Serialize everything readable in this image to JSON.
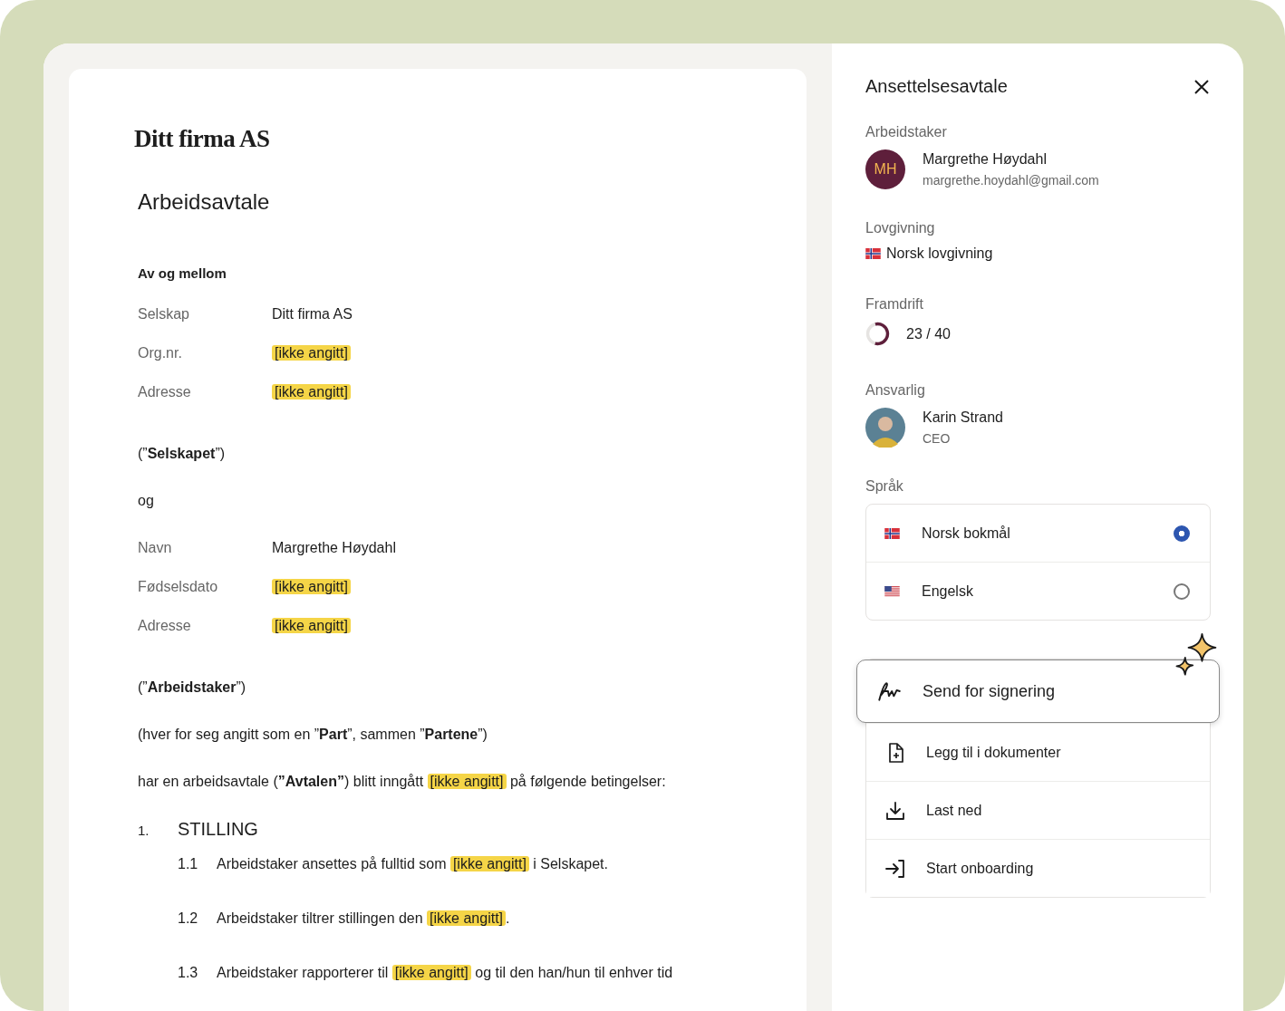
{
  "document": {
    "company": "Ditt firma AS",
    "title": "Arbeidsavtale",
    "parties_heading": "Av og mellom",
    "company_fields": [
      {
        "label": "Selskap",
        "value": "Ditt firma AS",
        "kind": "text"
      },
      {
        "label": "Org.nr.",
        "value": "[ikke angitt]",
        "kind": "placeholder"
      },
      {
        "label": "Adresse",
        "value": "[ikke angitt]",
        "kind": "placeholder"
      }
    ],
    "company_alias": [
      {
        "text": "(”",
        "kind": "plain"
      },
      {
        "text": "Selskapet",
        "kind": "bold"
      },
      {
        "text": "”)",
        "kind": "plain"
      }
    ],
    "conjunction": "og",
    "employee_fields": [
      {
        "label": "Navn",
        "value": "Margrethe Høydahl",
        "kind": "text"
      },
      {
        "label": "Fødselsdato",
        "value": "[ikke angitt]",
        "kind": "placeholder"
      },
      {
        "label": "Adresse",
        "value": "[ikke angitt]",
        "kind": "placeholder"
      }
    ],
    "paragraphs": [
      [
        {
          "text": "(”",
          "kind": "plain"
        },
        {
          "text": "Arbeidstaker",
          "kind": "bold"
        },
        {
          "text": "”)",
          "kind": "plain"
        }
      ],
      [
        {
          "text": "(hver for seg angitt som en ”",
          "kind": "plain"
        },
        {
          "text": "Part",
          "kind": "bold"
        },
        {
          "text": "”, sammen ”",
          "kind": "plain"
        },
        {
          "text": "Partene",
          "kind": "bold"
        },
        {
          "text": "”)",
          "kind": "plain"
        }
      ],
      [
        {
          "text": "har en arbeidsavtale (",
          "kind": "plain"
        },
        {
          "text": "”Avtalen”",
          "kind": "bold"
        },
        {
          "text": ") blitt inngått ",
          "kind": "plain"
        },
        {
          "text": "[ikke angitt]",
          "kind": "placeholder"
        },
        {
          "text": " på følgende betingelser:",
          "kind": "plain"
        }
      ]
    ],
    "sections": [
      {
        "number": "1.",
        "title": "STILLING",
        "clauses": [
          {
            "number": "1.1",
            "segments": [
              {
                "text": "Arbeidstaker ansettes på fulltid som ",
                "kind": "plain"
              },
              {
                "text": "[ikke angitt]",
                "kind": "placeholder"
              },
              {
                "text": " i Selskapet.",
                "kind": "plain"
              }
            ]
          },
          {
            "number": "1.2",
            "segments": [
              {
                "text": "Arbeidstaker tiltrer stillingen den ",
                "kind": "plain"
              },
              {
                "text": "[ikke angitt]",
                "kind": "placeholder"
              },
              {
                "text": ".",
                "kind": "plain"
              }
            ]
          },
          {
            "number": "1.3",
            "segments": [
              {
                "text": "Arbeidstaker rapporterer til ",
                "kind": "plain"
              },
              {
                "text": "[ikke angitt]",
                "kind": "placeholder"
              },
              {
                "text": " og til den han/hun til enhver tid",
                "kind": "plain"
              }
            ]
          }
        ]
      }
    ]
  },
  "panel": {
    "title": "Ansettelsesavtale",
    "employee": {
      "label": "Arbeidstaker",
      "initials": "MH",
      "name": "Margrethe Høydahl",
      "email": "margrethe.hoydahl@gmail.com"
    },
    "legislation": {
      "label": "Lovgivning",
      "value": "Norsk lovgivning"
    },
    "progress": {
      "label": "Framdrift",
      "level": 0.575,
      "reading": "23 / 40"
    },
    "responsible": {
      "label": "Ansvarlig",
      "name": "Karin Strand",
      "role": "CEO"
    },
    "language": {
      "label": "Språk",
      "options": [
        {
          "name": "Norsk bokmål",
          "kind": "no",
          "selected": true
        },
        {
          "name": "Engelsk",
          "kind": "us",
          "selected": false
        }
      ]
    },
    "actions": [
      {
        "label": "Send for signering",
        "kind": "signature",
        "selected": true
      },
      {
        "label": "Legg til i dokumenter",
        "kind": "file-plus",
        "selected": false
      },
      {
        "label": "Last ned",
        "kind": "download",
        "selected": false
      },
      {
        "label": "Start onboarding",
        "kind": "enter",
        "selected": false
      }
    ]
  }
}
